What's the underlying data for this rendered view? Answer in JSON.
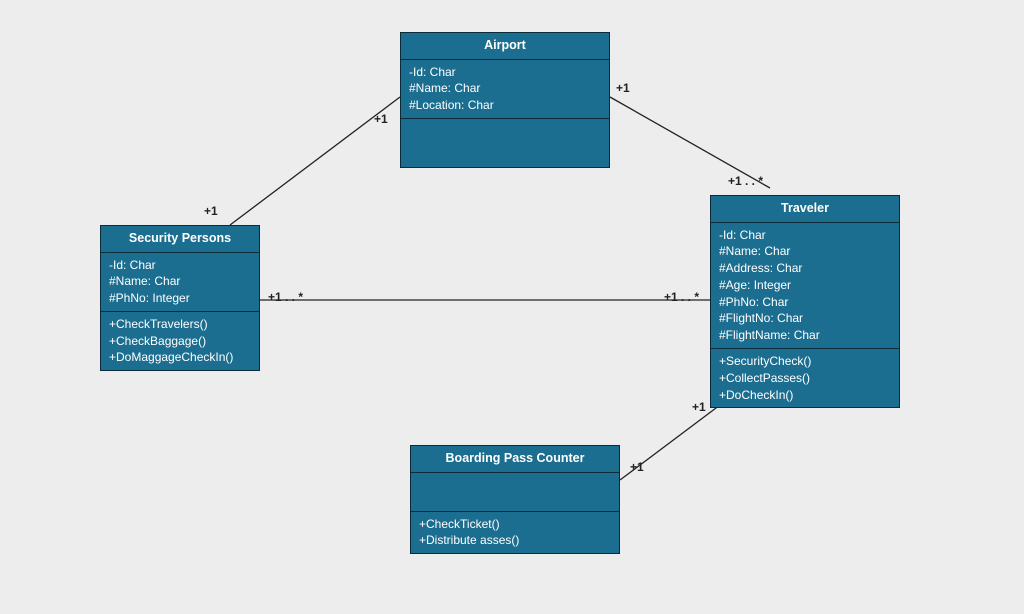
{
  "classes": {
    "airport": {
      "title": "Airport",
      "attributes": [
        "-Id: Char",
        "#Name: Char",
        "#Location: Char"
      ],
      "methods": []
    },
    "traveler": {
      "title": "Traveler",
      "attributes": [
        "-Id: Char",
        "#Name: Char",
        "#Address: Char",
        "#Age: Integer",
        "#PhNo: Char",
        "#FlightNo: Char",
        "#FlightName: Char"
      ],
      "methods": [
        "+SecurityCheck()",
        "+CollectPasses()",
        "+DoCheckIn()"
      ]
    },
    "security": {
      "title": "Security Persons",
      "attributes": [
        "-Id: Char",
        "#Name: Char",
        "#PhNo: Integer"
      ],
      "methods": [
        "+CheckTravelers()",
        "+CheckBaggage()",
        "+DoMaggageCheckIn()"
      ]
    },
    "boarding": {
      "title": "Boarding Pass Counter",
      "attributes": [],
      "methods": [
        "+CheckTicket()",
        "+Distribute asses()"
      ]
    }
  },
  "multiplicities": {
    "airport_security_top": "+1",
    "airport_security_bottom": "+1",
    "airport_traveler_top": "+1",
    "airport_traveler_bottom": "+1 . . *",
    "security_traveler_left": "+1 . . *",
    "security_traveler_right": "+1 . . *",
    "traveler_boarding_top": "+1",
    "traveler_boarding_bottom": "+1"
  }
}
